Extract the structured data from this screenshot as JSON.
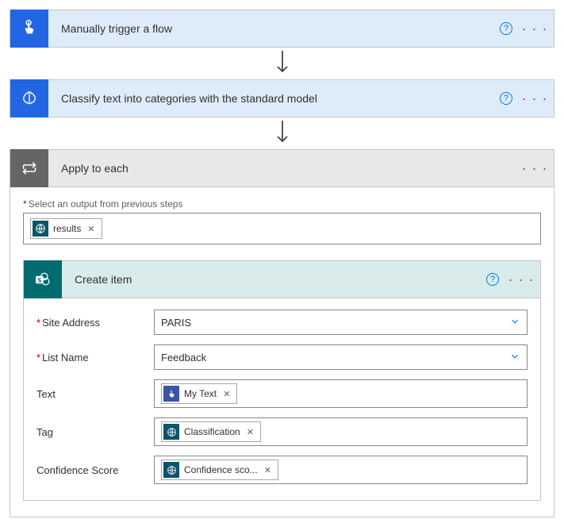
{
  "step1": {
    "title": "Manually trigger a flow"
  },
  "step2": {
    "title": "Classify text into categories with the standard model"
  },
  "step3": {
    "title": "Apply to each",
    "output_label": "Select an output from previous steps",
    "output_chip": "results"
  },
  "create_item": {
    "title": "Create item",
    "fields": {
      "site_address": {
        "label": "Site Address",
        "value": "PARIS"
      },
      "list_name": {
        "label": "List Name",
        "value": "Feedback"
      },
      "text": {
        "label": "Text",
        "chip": "My Text"
      },
      "tag": {
        "label": "Tag",
        "chip": "Classification"
      },
      "confidence": {
        "label": "Confidence Score",
        "chip": "Confidence sco..."
      }
    }
  }
}
